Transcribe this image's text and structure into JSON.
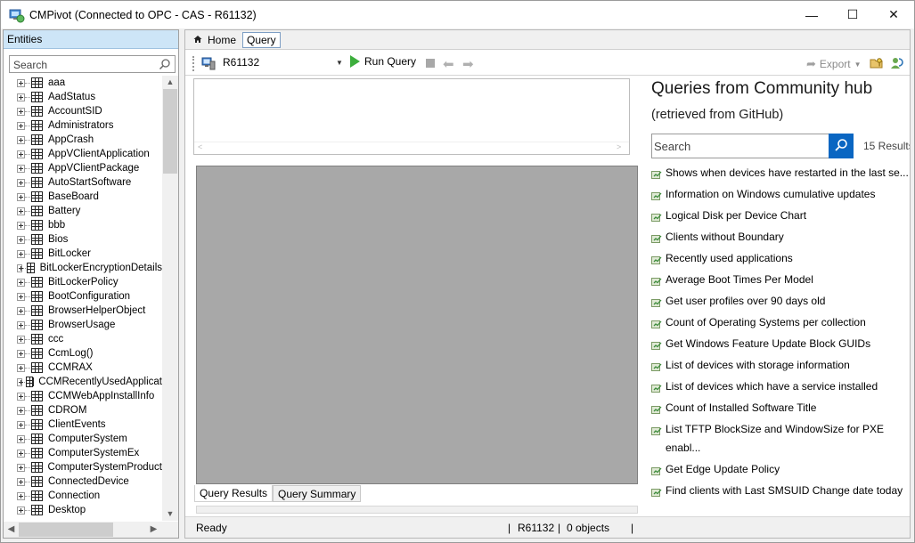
{
  "window": {
    "title": "CMPivot (Connected to OPC - CAS - R61132)",
    "controls": {
      "minimize": "—",
      "maximize": "☐",
      "close": "✕"
    }
  },
  "entities_pane": {
    "header": "Entities",
    "search_placeholder": "Search",
    "items": [
      "aaa",
      "AadStatus",
      "AccountSID",
      "Administrators",
      "AppCrash",
      "AppVClientApplication",
      "AppVClientPackage",
      "AutoStartSoftware",
      "BaseBoard",
      "Battery",
      "bbb",
      "Bios",
      "BitLocker",
      "BitLockerEncryptionDetails",
      "BitLockerPolicy",
      "BootConfiguration",
      "BrowserHelperObject",
      "BrowserUsage",
      "ccc",
      "CcmLog()",
      "CCMRAX",
      "CCMRecentlyUsedApplicat",
      "CCMWebAppInstallInfo",
      "CDROM",
      "ClientEvents",
      "ComputerSystem",
      "ComputerSystemEx",
      "ComputerSystemProduct",
      "ConnectedDevice",
      "Connection",
      "Desktop"
    ]
  },
  "tabs": {
    "home": "Home",
    "query": "Query"
  },
  "toolbar": {
    "device": "R61132",
    "run_query": "Run Query",
    "export": "Export"
  },
  "results_tabs": {
    "results": "Query Results",
    "summary": "Query Summary"
  },
  "status": {
    "state": "Ready",
    "device": "R61132",
    "objects": "0 objects",
    "sep": "|"
  },
  "hub": {
    "title": "Queries from Community hub",
    "subtitle": "(retrieved from GitHub)",
    "search_placeholder": "Search",
    "result_count": "15 Results",
    "queries": [
      "Shows when devices have restarted in the last se...",
      "Information on Windows cumulative updates",
      "Logical Disk per Device Chart",
      "Clients without Boundary",
      "Recently used applications",
      "Average Boot Times Per Model",
      "Get user profiles over 90 days old",
      "Count of Operating Systems per collection",
      "Get Windows Feature Update Block GUIDs",
      "List of devices with storage information",
      "List of devices which have a service installed",
      "Count of Installed Software Title",
      "List TFTP BlockSize and WindowSize for PXE enabl...",
      "Get Edge Update Policy",
      "Find clients with Last SMSUID Change date today"
    ]
  },
  "colors": {
    "entities_header_bg": "#cde5f7",
    "run_icon": "#3cae3c",
    "hub_search_button": "#0a66c2",
    "results_bg": "#a8a8a8"
  }
}
